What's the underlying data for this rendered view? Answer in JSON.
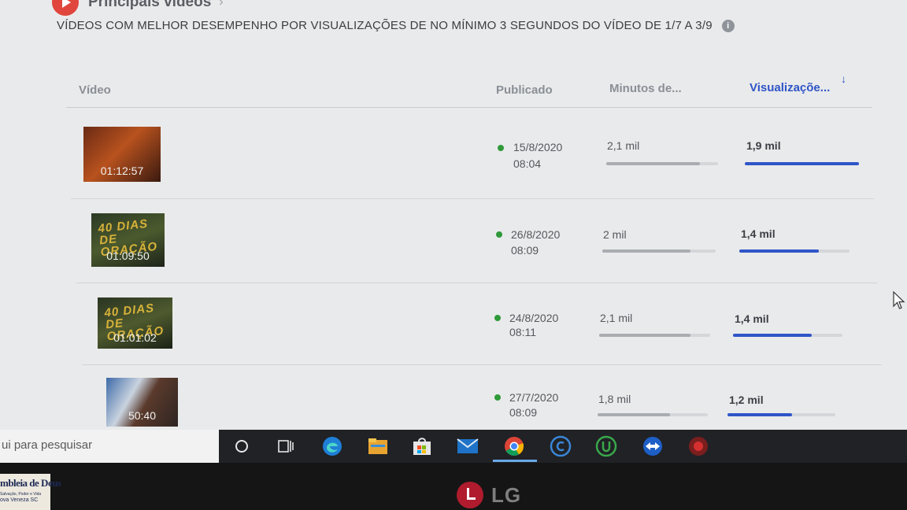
{
  "section": {
    "title": "Principais vídeos",
    "chevron": "›"
  },
  "subtitle": "VÍDEOS COM MELHOR DESEMPENHO POR VISUALIZAÇÕES DE NO MÍNIMO 3 SEGUNDOS DO VÍDEO DE 1/7 A 3/9",
  "info_icon": "i",
  "columns": {
    "video": "Vídeo",
    "published": "Publicado",
    "minutes": "Minutos de...",
    "views": "Visualizaçõe...",
    "sort_indicator": "↓"
  },
  "rows": [
    {
      "duration": "01:12:57",
      "thumb_text": "",
      "date": "15/8/2020",
      "time": "08:04",
      "minutes": "2,1 mil",
      "minutes_fill": 0.84,
      "views": "1,9 mil",
      "views_fill": 1.0
    },
    {
      "duration": "01:09:50",
      "thumb_text": "40 DIAS DE ORAÇÃO",
      "date": "26/8/2020",
      "time": "08:09",
      "minutes": "2 mil",
      "minutes_fill": 0.78,
      "views": "1,4 mil",
      "views_fill": 0.72
    },
    {
      "duration": "01:01:02",
      "thumb_text": "40 DIAS DE ORAÇÃO",
      "date": "24/8/2020",
      "time": "08:11",
      "minutes": "2,1 mil",
      "minutes_fill": 0.82,
      "views": "1,4 mil",
      "views_fill": 0.72
    },
    {
      "duration": "50:40",
      "thumb_text": "",
      "date": "27/7/2020",
      "time": "08:09",
      "minutes": "1,8 mil",
      "minutes_fill": 0.66,
      "views": "1,2 mil",
      "views_fill": 0.6
    }
  ],
  "taskbar": {
    "search_placeholder": "ui para pesquisar",
    "icons": [
      "cortana-icon",
      "task-view-icon",
      "edge-icon",
      "file-explorer-icon",
      "store-icon",
      "mail-icon",
      "chrome-icon",
      "app-c-icon",
      "app-u-icon",
      "app-teamviewer-icon",
      "app-red-icon"
    ]
  },
  "colors": {
    "accent_blue": "#2f55c8",
    "status_green": "#2f9a3a",
    "youtube_red": "#e0463c"
  },
  "sticker": {
    "line1": "mbleia de Deus",
    "line2": "Salvação, Poder e Vida",
    "line3": "ova Veneza SC"
  },
  "monitor_brand": "LG"
}
